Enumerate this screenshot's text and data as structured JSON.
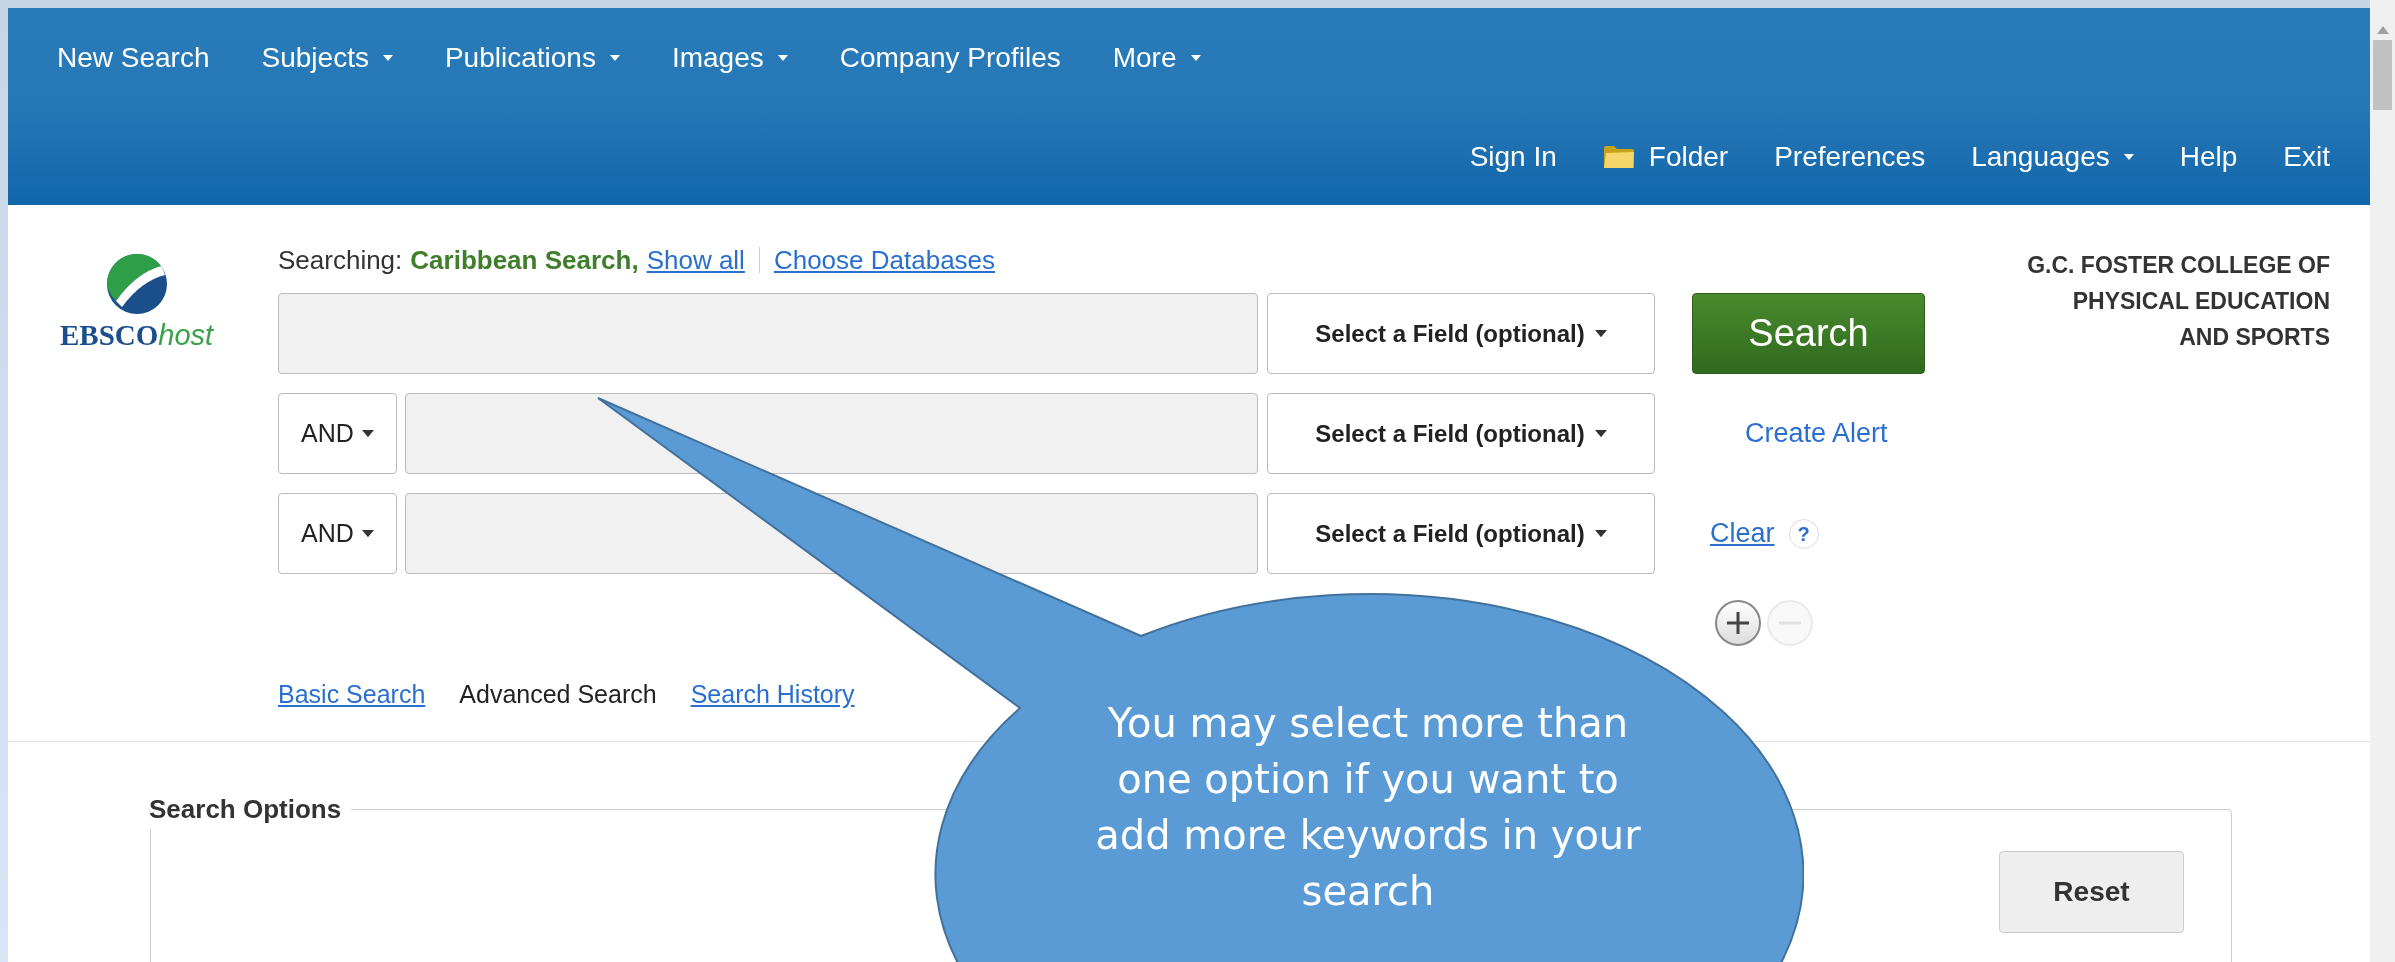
{
  "nav": {
    "primary": [
      {
        "label": "New Search",
        "has_dropdown": false
      },
      {
        "label": "Subjects",
        "has_dropdown": true
      },
      {
        "label": "Publications",
        "has_dropdown": true
      },
      {
        "label": "Images",
        "has_dropdown": true
      },
      {
        "label": "Company Profiles",
        "has_dropdown": false
      },
      {
        "label": "More",
        "has_dropdown": true
      }
    ],
    "secondary": [
      {
        "label": "Sign In",
        "has_dropdown": false,
        "kind": "link"
      },
      {
        "label": "Folder",
        "has_dropdown": false,
        "kind": "folder"
      },
      {
        "label": "Preferences",
        "has_dropdown": false,
        "kind": "link"
      },
      {
        "label": "Languages",
        "has_dropdown": true,
        "kind": "link"
      },
      {
        "label": "Help",
        "has_dropdown": false,
        "kind": "link"
      },
      {
        "label": "Exit",
        "has_dropdown": false,
        "kind": "link"
      }
    ]
  },
  "logo": {
    "brand": "EBSCO",
    "suffix": "host"
  },
  "searching": {
    "label": "Searching:",
    "database": "Caribbean Search,",
    "show_all": "Show all",
    "choose": "Choose Databases"
  },
  "search_rows": [
    {
      "operator": null,
      "value": "",
      "field": "Select a Field (optional)"
    },
    {
      "operator": "AND",
      "value": "",
      "field": "Select a Field (optional)"
    },
    {
      "operator": "AND",
      "value": "",
      "field": "Select a Field (optional)"
    }
  ],
  "search_button": "Search",
  "create_alert": "Create Alert",
  "clear": "Clear",
  "help_mark": "?",
  "remove_row": {
    "disabled": true
  },
  "modes": [
    {
      "label": "Basic Search",
      "selected": false
    },
    {
      "label": "Advanced Search",
      "selected": true
    },
    {
      "label": "Search History",
      "selected": false
    }
  ],
  "institution": [
    "G.C. FOSTER COLLEGE OF",
    "PHYSICAL EDUCATION",
    "AND SPORTS"
  ],
  "search_options": {
    "title": "Search Options",
    "reset": "Reset"
  },
  "callout": "You may select more than one option if you want to add more keywords in your search"
}
